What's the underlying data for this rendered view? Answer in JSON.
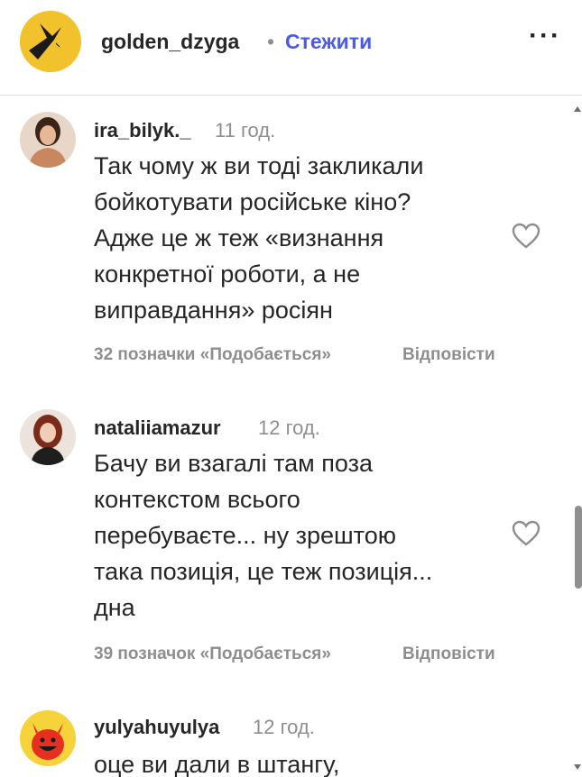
{
  "header": {
    "username": "golden_dzyga",
    "dot": "•",
    "follow_label": "Стежити",
    "more": "···"
  },
  "comments": [
    {
      "username": "ira_bilyk._",
      "time": "11 год.",
      "lines": [
        "Так чому ж ви тоді закликали",
        "бойкотувати російське кіно?",
        "Адже це ж теж «визнання",
        "конкретної роботи, а не",
        "виправдання» росіян"
      ],
      "likes": "32 позначки «Подобається»",
      "reply": "Відповісти"
    },
    {
      "username": "nataliiamazur",
      "time": "12 год.",
      "lines": [
        "Бачу ви взагалі там поза",
        "контекстом всього",
        "перебуваєте... ну зрештою",
        "така позиція, це теж позиція...",
        "дна"
      ],
      "likes": "39 позначок «Подобається»",
      "reply": "Відповісти"
    },
    {
      "username": "yulyahuyulya",
      "time": "12 год.",
      "lines": [
        "оце ви дали в штангу,"
      ]
    }
  ],
  "icons": {
    "heart": "heart-icon",
    "more": "more-options-icon"
  },
  "colors": {
    "follow": "#4a5be8",
    "logo_bg": "#f2c22d",
    "secondary_text": "#8e8e8e"
  }
}
